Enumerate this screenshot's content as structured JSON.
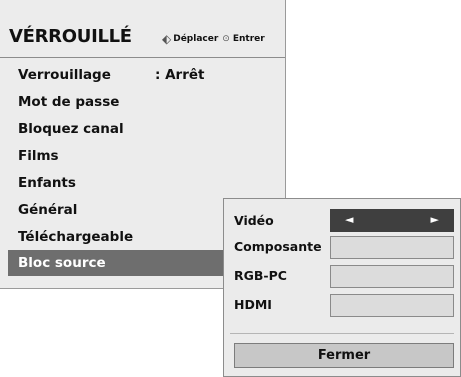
{
  "header": {
    "title": "VÉRROUILLÉ",
    "move_icon": "four-way-arrows-icon",
    "move_label": "Déplacer",
    "enter_icon": "enter-circle-icon",
    "enter_label": "Entrer"
  },
  "menu": {
    "items": [
      {
        "label": "Verrouillage",
        "value": ": Arrêt"
      },
      {
        "label": "Mot de passe"
      },
      {
        "label": "Bloquez canal"
      },
      {
        "label": "Films"
      },
      {
        "label": "Enfants"
      },
      {
        "label": "Général"
      },
      {
        "label": "Téléchargeable"
      },
      {
        "label": "Bloc source",
        "selected": true
      }
    ]
  },
  "submenu": {
    "rows": [
      {
        "label": "Vidéo",
        "active": true
      },
      {
        "label": "Composante"
      },
      {
        "label": "RGB-PC"
      },
      {
        "label": "HDMI"
      }
    ],
    "left_arrow": "◄",
    "right_arrow": "►",
    "close_label": "Fermer"
  },
  "colors": {
    "menu_bg": "#ececec",
    "selected_bg": "#6e6e6e",
    "active_box": "#3f3f3f",
    "inactive_box": "#dcdcdc",
    "button_bg": "#c7c7c7"
  }
}
